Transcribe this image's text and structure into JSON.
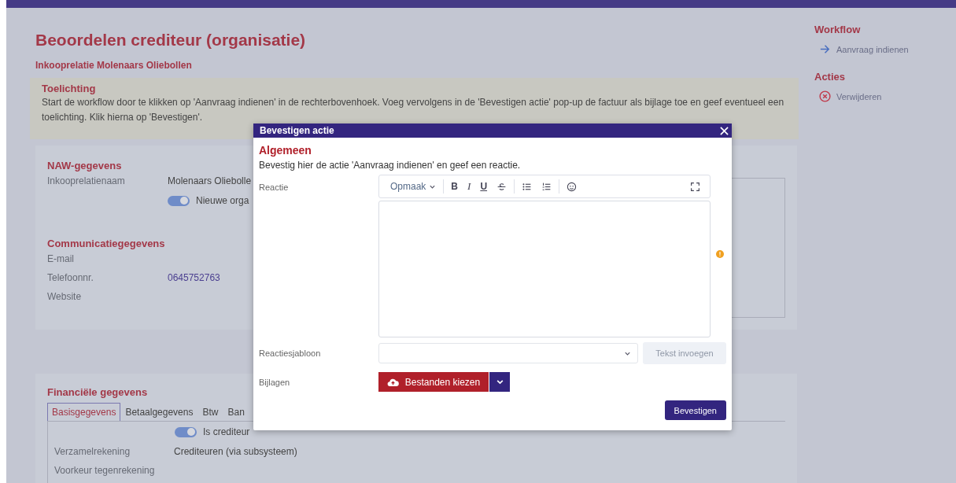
{
  "page": {
    "title": "Beoordelen crediteur (organisatie)",
    "subtitle": "Inkooprelatie Molenaars Oliebollen"
  },
  "info_panel": {
    "title": "Toelichting",
    "text": "Start de workflow door te klikken op 'Aanvraag indienen' in de rechterbovenhoek. Voeg vervolgens in de 'Bevestigen actie' pop-up de factuur als bijlage toe en geef eventueel een toelichting. Klik hierna op 'Bevestigen'."
  },
  "naw": {
    "title": "NAW-gegevens",
    "fields": [
      {
        "label": "Inkooprelatienaam",
        "value": "Molenaars Oliebolle"
      }
    ],
    "toggle": {
      "label": "Nieuwe orga",
      "on": true
    }
  },
  "communication": {
    "title": "Communicatiegegevens",
    "fields": [
      {
        "label": "E-mail"
      },
      {
        "label": "Telefoonnr.",
        "value": "0645752763",
        "link": true
      },
      {
        "label": "Website"
      }
    ]
  },
  "financial": {
    "title": "Financiële gegevens",
    "tabs": [
      {
        "label": "Basisgegevens",
        "selected": true
      },
      {
        "label": "Betaalgegevens",
        "selected": false
      },
      {
        "label": "Btw",
        "selected": false
      },
      {
        "label": "Ban",
        "selected": false
      }
    ],
    "toggle": {
      "label": "Is crediteur",
      "on": true
    },
    "fields": [
      {
        "label": "Verzamelrekening",
        "value": "Crediteuren (via subsysteem)"
      },
      {
        "label": "Voorkeur tegenrekening"
      }
    ]
  },
  "sidebar": {
    "sections": [
      {
        "title": "Workflow",
        "items": [
          {
            "label": "Aanvraag indienen",
            "kind": "arrow"
          }
        ]
      },
      {
        "title": "Acties",
        "items": [
          {
            "label": "Verwijderen",
            "kind": "remove"
          }
        ]
      }
    ]
  },
  "dialog": {
    "title": "Bevestigen actie",
    "section": "Algemeen",
    "description": "Bevestig hier de actie 'Aanvraag indienen' en geef een reactie.",
    "reaction_label": "Reactie",
    "toolbar": [
      {
        "kind": "format",
        "label": "Opmaak"
      },
      {
        "kind": "bold",
        "label": "B"
      },
      {
        "kind": "italic",
        "label": "I"
      },
      {
        "kind": "underline",
        "label": "U"
      },
      {
        "kind": "strike"
      },
      {
        "kind": "bullets"
      },
      {
        "kind": "numbers"
      },
      {
        "kind": "emoji"
      },
      {
        "kind": "fullscreen"
      }
    ],
    "template_label": "Reactiesjabloon",
    "insert_button": {
      "label": "Tekst invoegen",
      "disabled": true
    },
    "attachments_label": "Bijlagen",
    "upload_button": "Bestanden kiezen",
    "confirm_button": "Bevestigen"
  }
}
